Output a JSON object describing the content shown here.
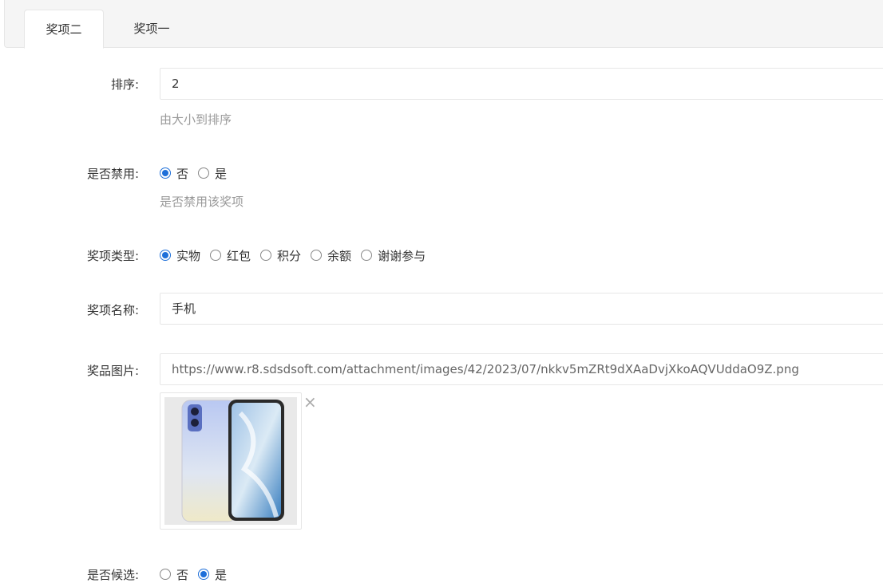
{
  "tabs": [
    {
      "label": "奖项二",
      "active": true
    },
    {
      "label": "奖项一",
      "active": false
    }
  ],
  "form": {
    "sort": {
      "label": "排序:",
      "value": "2",
      "help": "由大小到排序"
    },
    "disabled": {
      "label": "是否禁用:",
      "options": [
        "否",
        "是"
      ],
      "selected": "否",
      "help": "是否禁用该奖项"
    },
    "prize_type": {
      "label": "奖项类型:",
      "options": [
        "实物",
        "红包",
        "积分",
        "余额",
        "谢谢参与"
      ],
      "selected": "实物"
    },
    "prize_name": {
      "label": "奖项名称:",
      "value": "手机"
    },
    "prize_image": {
      "label": "奖品图片:",
      "value": "https://www.r8.sdsdsoft.com/attachment/images/42/2023/07/nkkv5mZRt9dXAaDvjXkoAQVUddaO9Z.png",
      "remove": "×"
    },
    "candidate": {
      "label": "是否候选:",
      "options": [
        "否",
        "是"
      ],
      "selected": "是"
    }
  },
  "colors": {
    "accent": "#1e6fd9",
    "border": "#e6e6e6",
    "help_text": "#999999"
  }
}
